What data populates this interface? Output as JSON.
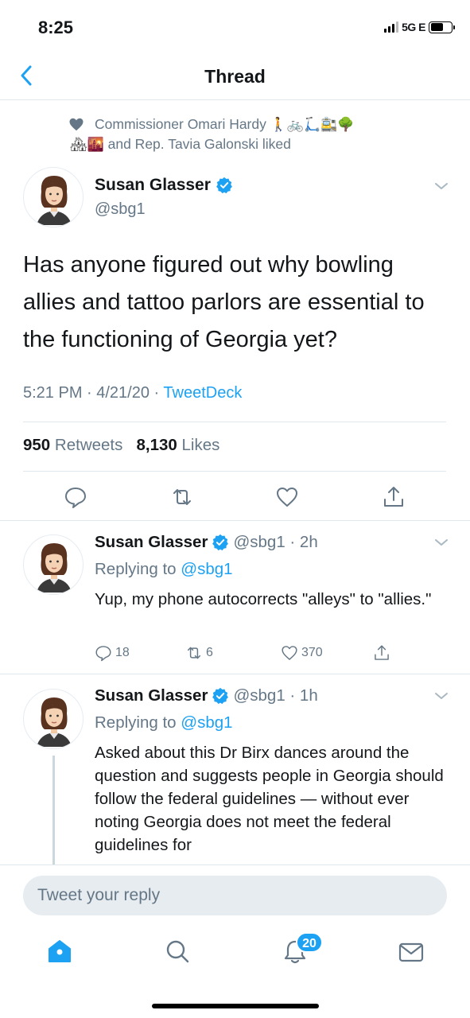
{
  "status": {
    "time": "8:25",
    "network": "5G E"
  },
  "nav": {
    "title": "Thread"
  },
  "social_context": {
    "line1_text": "Commissioner Omari Hardy",
    "line1_emojis": "🚶🚲🛴🚉🌳",
    "line2_emojis": "🏘🌇",
    "line2_text": "and Rep. Tavia Galonski liked"
  },
  "main_tweet": {
    "name": "Susan Glasser",
    "handle": "@sbg1",
    "text": "Has anyone figured out why bowling allies and tattoo parlors are essential to the functioning of Georgia yet?",
    "time": "5:21 PM · 4/21/20 · ",
    "source": "TweetDeck",
    "retweets_count": "950",
    "retweets_label": "Retweets",
    "likes_count": "8,130",
    "likes_label": "Likes"
  },
  "replies": [
    {
      "name": "Susan Glasser",
      "handle_time": "@sbg1 · 2h",
      "replying_label": "Replying to",
      "replying_to": "@sbg1",
      "text": "Yup, my phone autocorrects \"alleys\" to \"allies.\"",
      "reply_count": "18",
      "retweet_count": "6",
      "like_count": "370"
    },
    {
      "name": "Susan Glasser",
      "handle_time": "@sbg1 · 1h",
      "replying_label": "Replying to",
      "replying_to": "@sbg1",
      "text": "Asked about this Dr Birx dances around the question and suggests people in Georgia should follow the federal guidelines — without ever noting Georgia does not meet the federal guidelines for"
    }
  ],
  "compose": {
    "placeholder": "Tweet your reply"
  },
  "tabbar": {
    "notifications_badge": "20"
  },
  "colors": {
    "accent": "#1da1f2",
    "secondary_text": "#657786",
    "divider": "#e1e8ed"
  }
}
